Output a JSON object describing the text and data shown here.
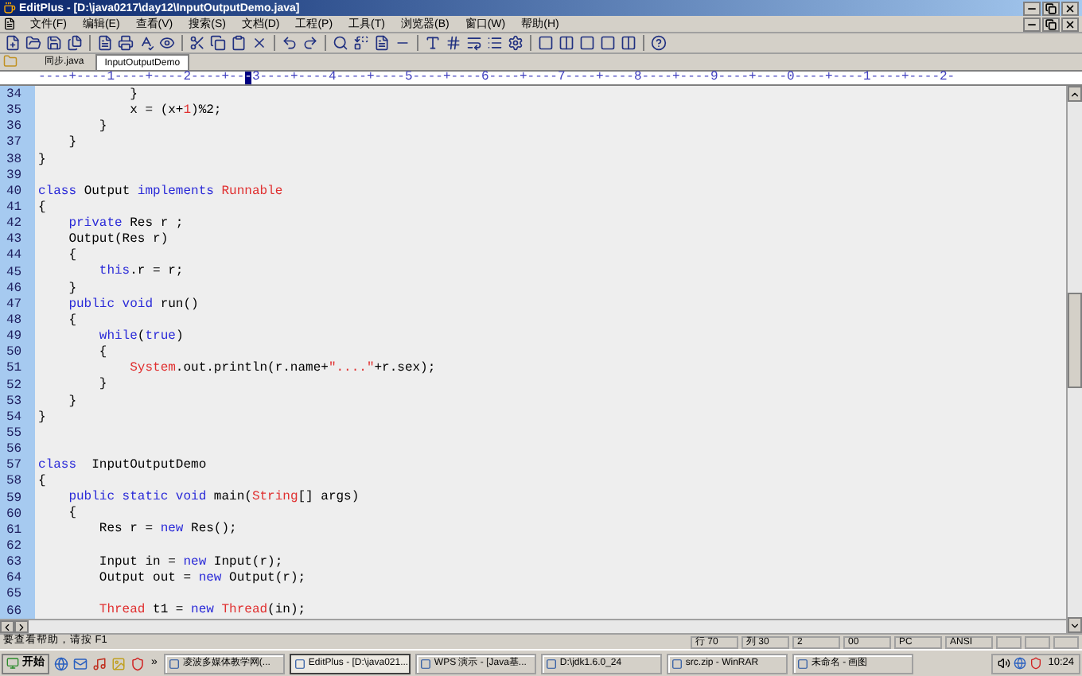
{
  "window": {
    "title": "EditPlus - [D:\\java0217\\day12\\InputOutputDemo.java]"
  },
  "menu": [
    "文件(F)",
    "编辑(E)",
    "查看(V)",
    "搜索(S)",
    "文档(D)",
    "工程(P)",
    "工具(T)",
    "浏览器(B)",
    "窗口(W)",
    "帮助(H)"
  ],
  "tabs": [
    {
      "label": "同步.java",
      "selected": false
    },
    {
      "label": "InputOutputDemo",
      "selected": true
    }
  ],
  "ruler": {
    "before": "----+----1----+----2----+--",
    "cursor": "-",
    "after": "3----+----4----+----5----+----6----+----7----+----8----+----9----+----0----+----1----+----2-"
  },
  "code": [
    {
      "number": "34",
      "tokens": [
        {
          "text": "            }",
          "kind": "plain"
        }
      ]
    },
    {
      "number": "35",
      "tokens": [
        {
          "text": "            x = (x+",
          "kind": "plain"
        },
        {
          "text": "1",
          "kind": "number"
        },
        {
          "text": ")%2;",
          "kind": "plain"
        }
      ]
    },
    {
      "number": "36",
      "tokens": [
        {
          "text": "        }",
          "kind": "plain"
        }
      ]
    },
    {
      "number": "37",
      "tokens": [
        {
          "text": "    }",
          "kind": "plain"
        }
      ]
    },
    {
      "number": "38",
      "tokens": [
        {
          "text": "}",
          "kind": "plain"
        }
      ]
    },
    {
      "number": "39"
    },
    {
      "number": "40",
      "tokens": [
        {
          "text": "class",
          "kind": "keyword"
        },
        {
          "text": " Output ",
          "kind": "plain"
        },
        {
          "text": "implements",
          "kind": "keyword"
        },
        {
          "text": " Runnable",
          "kind": "type"
        }
      ]
    },
    {
      "number": "41",
      "tokens": [
        {
          "text": "{",
          "kind": "plain"
        }
      ]
    },
    {
      "number": "42",
      "tokens": [
        {
          "text": "    private",
          "kind": "keyword"
        },
        {
          "text": " Res r ;",
          "kind": "plain"
        }
      ]
    },
    {
      "number": "43",
      "tokens": [
        {
          "text": "    Output(Res r)",
          "kind": "plain"
        }
      ]
    },
    {
      "number": "44",
      "tokens": [
        {
          "text": "    {",
          "kind": "plain"
        }
      ]
    },
    {
      "number": "45",
      "tokens": [
        {
          "text": "        this",
          "kind": "keyword"
        },
        {
          "text": ".r = r;",
          "kind": "plain"
        }
      ]
    },
    {
      "number": "46",
      "tokens": [
        {
          "text": "    }",
          "kind": "plain"
        }
      ]
    },
    {
      "number": "47",
      "tokens": [
        {
          "text": "    public void",
          "kind": "keyword"
        },
        {
          "text": " run()",
          "kind": "plain"
        }
      ]
    },
    {
      "number": "48",
      "tokens": [
        {
          "text": "    {",
          "kind": "plain"
        }
      ]
    },
    {
      "number": "49",
      "tokens": [
        {
          "text": "        while",
          "kind": "keyword"
        },
        {
          "text": "(",
          "kind": "plain"
        },
        {
          "text": "true",
          "kind": "keyword"
        },
        {
          "text": ")",
          "kind": "plain"
        }
      ]
    },
    {
      "number": "50",
      "tokens": [
        {
          "text": "        {",
          "kind": "plain"
        }
      ]
    },
    {
      "number": "51",
      "tokens": [
        {
          "text": "            System",
          "kind": "type"
        },
        {
          "text": ".out.println(r.name+",
          "kind": "plain"
        },
        {
          "text": "\"....\"",
          "kind": "string"
        },
        {
          "text": "+r.sex);",
          "kind": "plain"
        }
      ]
    },
    {
      "number": "52",
      "tokens": [
        {
          "text": "        }",
          "kind": "plain"
        }
      ]
    },
    {
      "number": "53",
      "tokens": [
        {
          "text": "    }",
          "kind": "plain"
        }
      ]
    },
    {
      "number": "54",
      "tokens": [
        {
          "text": "}",
          "kind": "plain"
        }
      ]
    },
    {
      "number": "55"
    },
    {
      "number": "56"
    },
    {
      "number": "57",
      "tokens": [
        {
          "text": "class",
          "kind": "keyword"
        },
        {
          "text": "  InputOutputDemo",
          "kind": "plain"
        }
      ]
    },
    {
      "number": "58",
      "tokens": [
        {
          "text": "{",
          "kind": "plain"
        }
      ]
    },
    {
      "number": "59",
      "tokens": [
        {
          "text": "    public static void",
          "kind": "keyword"
        },
        {
          "text": " main(",
          "kind": "plain"
        },
        {
          "text": "String",
          "kind": "type"
        },
        {
          "text": "[] args)",
          "kind": "plain"
        }
      ]
    },
    {
      "number": "60",
      "tokens": [
        {
          "text": "    {",
          "kind": "plain"
        }
      ]
    },
    {
      "number": "61",
      "tokens": [
        {
          "text": "        Res r = ",
          "kind": "plain"
        },
        {
          "text": "new",
          "kind": "keyword"
        },
        {
          "text": " Res();",
          "kind": "plain"
        }
      ]
    },
    {
      "number": "62"
    },
    {
      "number": "63",
      "tokens": [
        {
          "text": "        Input in = ",
          "kind": "plain"
        },
        {
          "text": "new",
          "kind": "keyword"
        },
        {
          "text": " Input(r);",
          "kind": "plain"
        }
      ]
    },
    {
      "number": "64",
      "tokens": [
        {
          "text": "        Output out = ",
          "kind": "plain"
        },
        {
          "text": "new",
          "kind": "keyword"
        },
        {
          "text": " Output(r);",
          "kind": "plain"
        }
      ]
    },
    {
      "number": "65"
    },
    {
      "number": "66",
      "tokens": [
        {
          "text": "        Thread",
          "kind": "type"
        },
        {
          "text": " t1 = ",
          "kind": "plain"
        },
        {
          "text": "new",
          "kind": "keyword"
        },
        {
          "text": " Thread",
          "kind": "type"
        },
        {
          "text": "(in);",
          "kind": "plain"
        }
      ]
    }
  ],
  "status_bar": {
    "hint": "要查看帮助，请按 F1",
    "cells": [
      "行 70",
      "列 30",
      "2",
      "00",
      "PC",
      "ANSI"
    ]
  },
  "taskbar": {
    "start": "开始",
    "more": "»",
    "tasks": [
      {
        "label": "凌波多媒体教学网(...",
        "selected": false
      },
      {
        "label": "EditPlus - [D:\\java021...",
        "selected": true
      },
      {
        "label": "WPS 演示 - [Java基...",
        "selected": false
      },
      {
        "label": "D:\\jdk1.6.0_24",
        "selected": false
      },
      {
        "label": "src.zip - WinRAR",
        "selected": false
      },
      {
        "label": "未命名 - 画图",
        "selected": false
      }
    ],
    "clock": "10:24"
  }
}
